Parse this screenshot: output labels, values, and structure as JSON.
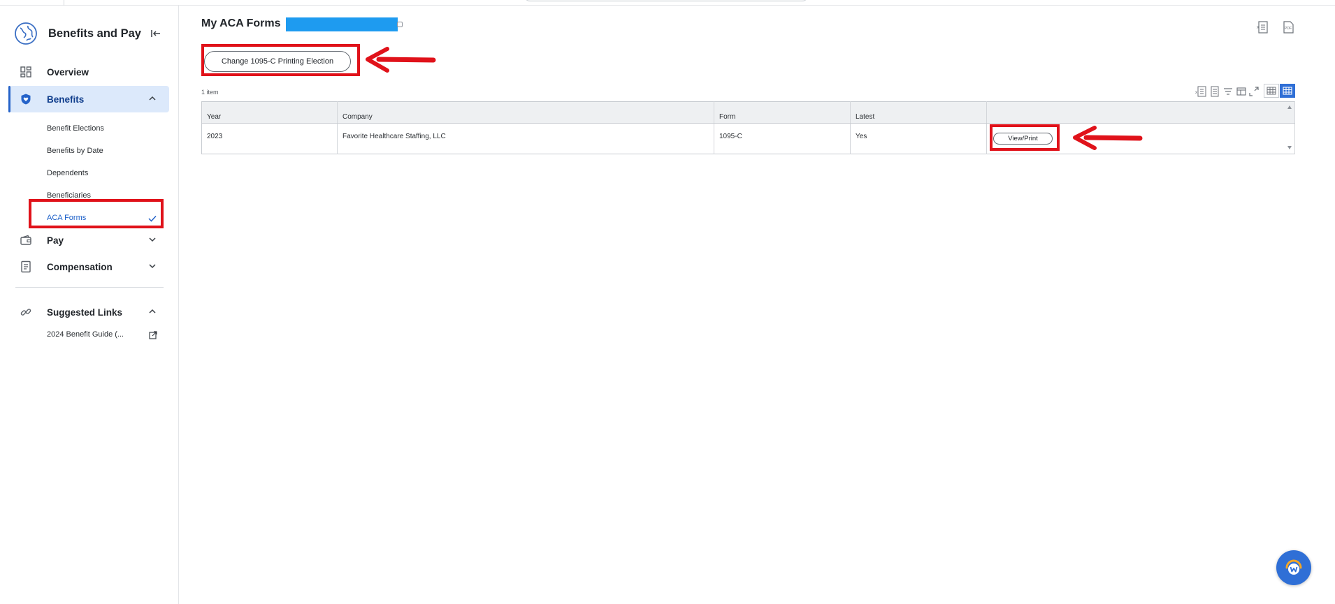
{
  "app": {
    "title": "Benefits and Pay"
  },
  "sidebar": {
    "items": [
      {
        "label": "Overview",
        "icon": "grid-icon"
      },
      {
        "label": "Benefits",
        "icon": "shield-heart-icon",
        "expanded": true,
        "active": true
      },
      {
        "label": "Pay",
        "icon": "wallet-icon",
        "expanded": false
      },
      {
        "label": "Compensation",
        "icon": "document-icon",
        "expanded": false
      }
    ],
    "benefits_sub": [
      {
        "label": "Benefit Elections"
      },
      {
        "label": "Benefits by Date"
      },
      {
        "label": "Dependents"
      },
      {
        "label": "Beneficiaries"
      },
      {
        "label": "ACA Forms",
        "current": true
      }
    ],
    "suggested": {
      "label": "Suggested Links",
      "icon": "link-icon",
      "links": [
        {
          "label": "2024 Benefit Guide (..."
        }
      ]
    }
  },
  "main": {
    "title": "My ACA Forms",
    "change_button": "Change 1095-C Printing Election",
    "item_count": "1 item",
    "table": {
      "columns": [
        "Year",
        "Company",
        "Form",
        "Latest",
        ""
      ],
      "rows": [
        {
          "year": "2023",
          "company": "Favorite Healthcare Staffing, LLC",
          "form": "1095-C",
          "latest": "Yes",
          "action": "View/Print"
        }
      ]
    }
  },
  "colors": {
    "accent": "#2563c9",
    "active_bg": "#dce9fb",
    "annotation_red": "#e0121a",
    "redaction_blue": "#1e9bf0"
  }
}
